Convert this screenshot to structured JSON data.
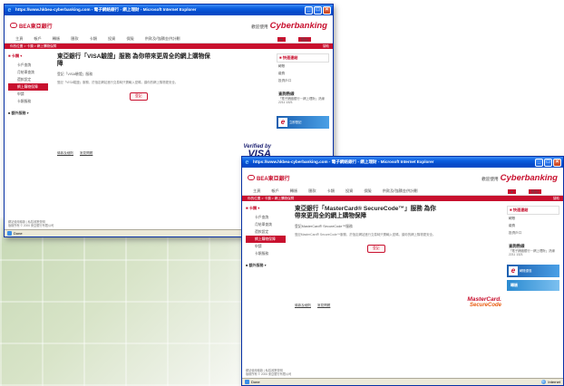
{
  "windows": [
    {
      "title": "https://www.hkbea-cyberbanking.com - 電子網絡銀行 - 網上理財 - Microsoft Internet Explorer",
      "bank_logo": "BEA東亞銀行",
      "header_pre": "歡迎使用",
      "brand": "Cyberbanking",
      "nav": [
        "主頁",
        "帳戶",
        "轉賬",
        "匯款",
        "卡類",
        "投資",
        "保險",
        "供款及/強積金供計劃"
      ],
      "tools": [
        "●",
        "登出"
      ],
      "redbar_left": "你的位置 > 卡類 > 網上購物保障",
      "redbar_right": "幫助",
      "sidebar_head": "■ 卡類 ▾",
      "sidebar_items": [
        "卡戶查詢",
        "月結單查詢",
        "還款設定",
        "網上購物保障",
        "申請",
        "卡類服務"
      ],
      "sidebar_active": 3,
      "sidebar_head2": "■ 額外服務 ▾",
      "headline": "東亞銀行「VISA驗證」服務 為你帶來更周全的網上購物保障",
      "sub": "登記「VISA驗證」服務",
      "para": "登記「VISA驗證」服務，於指定網站進行交易時只需輸入密碼，讓你的網上購物更安全。",
      "button": "登記",
      "links": [
        "條款及細則",
        "常見問題"
      ],
      "seal_line1": "Verified by",
      "seal_line2": "VISA",
      "right_head": "■ 快速連結",
      "right_items": [
        "轉賬",
        "繳費",
        "投資戶口"
      ],
      "hotline_head": "查詢熱線",
      "hotline_text": "「電子網絡銀行－網上理財」熱線",
      "hotline_number": "2211 1321",
      "banner1": "立即登記",
      "footer1": "網站使用條款 | 私隱政策聲明",
      "footer2": "版權所有 © 2006 東亞銀行有限公司",
      "status_left": "Done",
      "status_right": "Internet"
    },
    {
      "title": "https://www.hkbea-cyberbanking.com - 電子網絡銀行 - 網上理財 - Microsoft Internet Explorer",
      "bank_logo": "BEA東亞銀行",
      "header_pre": "歡迎使用",
      "brand": "Cyberbanking",
      "nav": [
        "主頁",
        "帳戶",
        "轉賬",
        "匯款",
        "卡類",
        "投資",
        "保險",
        "供款及/強積金供計劃"
      ],
      "tools": [
        "●",
        "登出"
      ],
      "redbar_left": "你的位置 > 卡類 > 網上購物保障",
      "redbar_right": "幫助",
      "sidebar_head": "■ 卡類 ▾",
      "sidebar_items": [
        "卡戶查詢",
        "月結單查詢",
        "還款設定",
        "網上購物保障",
        "申請",
        "卡類服務"
      ],
      "sidebar_active": 3,
      "sidebar_head2": "■ 額外服務 ▾",
      "headline": "東亞銀行「MasterCard® SecureCode™」服務 為你帶來更周全的網上購物保障",
      "sub": "登記MasterCard® SecureCode™服務",
      "para": "登記MasterCard® SecureCode™服務，於指定網站進行交易時只需輸入密碼，讓你的網上購物更安全。",
      "button": "登記",
      "links": [
        "條款及細則",
        "常見問題"
      ],
      "seal_line1": "MasterCard.",
      "seal_line2": "SecureCode",
      "right_head": "■ 快速連結",
      "right_items": [
        "轉賬",
        "繳費",
        "投資戶口"
      ],
      "hotline_head": "查詢熱線",
      "hotline_text": "「電子網絡銀行－網上理財」熱線",
      "hotline_number": "2211 1321",
      "banner1": "轉賬優惠",
      "banner2": "轉賬",
      "footer1": "網站使用條款 | 私隱政策聲明",
      "footer2": "版權所有 © 2006 東亞銀行有限公司",
      "status_left": "Done",
      "status_right": "Internet"
    }
  ]
}
